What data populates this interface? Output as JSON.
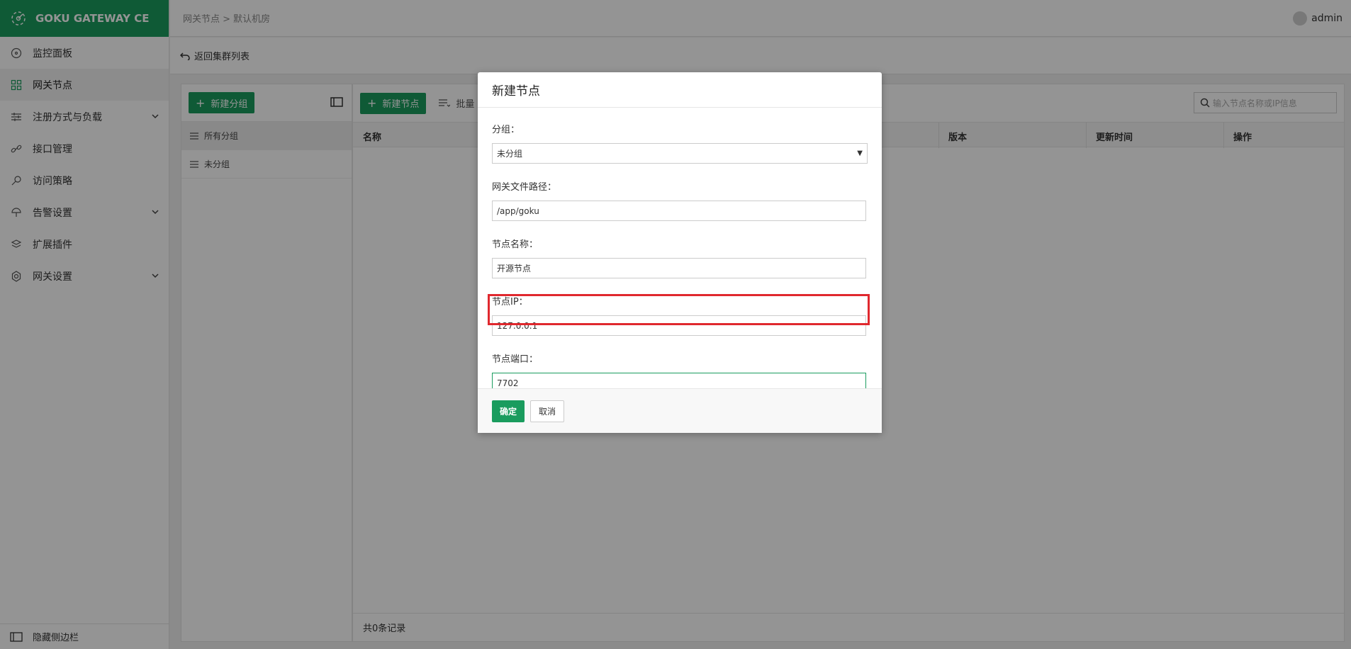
{
  "app": {
    "brand": "GOKU GATEWAY CE"
  },
  "sidebar": {
    "items": [
      {
        "label": "监控面板",
        "icon": "dashboard-icon"
      },
      {
        "label": "网关节点",
        "icon": "grid-icon"
      },
      {
        "label": "注册方式与负载",
        "icon": "sliders-icon"
      },
      {
        "label": "接口管理",
        "icon": "link-icon"
      },
      {
        "label": "访问策略",
        "icon": "key-icon"
      },
      {
        "label": "告警设置",
        "icon": "alert-icon"
      },
      {
        "label": "扩展插件",
        "icon": "layers-icon"
      },
      {
        "label": "网关设置",
        "icon": "gear-icon"
      }
    ],
    "footer": "隐藏侧边栏"
  },
  "header": {
    "breadcrumb": "网关节点 > 默认机房",
    "user": "admin"
  },
  "backbar": {
    "label": "返回集群列表"
  },
  "groups": {
    "new_button": "新建分组",
    "items": [
      "所有分组",
      "未分组"
    ]
  },
  "nodes": {
    "new_button": "新建节点",
    "batch_label": "批量",
    "search_placeholder": "输入节点名称或IP信息",
    "columns": [
      "名称",
      "版本",
      "更新时间",
      "操作"
    ],
    "footer": "共0条记录"
  },
  "modal": {
    "title": "新建节点",
    "fields": [
      {
        "label": "分组：",
        "value": "未分组",
        "type": "select"
      },
      {
        "label": "网关文件路径：",
        "value": "/app/goku",
        "type": "input"
      },
      {
        "label": "节点名称：",
        "value": "开源节点",
        "type": "input"
      },
      {
        "label": "节点IP：",
        "value": "127.0.0.1",
        "type": "input"
      },
      {
        "label": "节点端口：",
        "value": "7702",
        "type": "input"
      }
    ],
    "confirm": "确定",
    "cancel": "取消"
  },
  "colors": {
    "brand": "#1a9c5e",
    "highlight": "#e0282e"
  }
}
